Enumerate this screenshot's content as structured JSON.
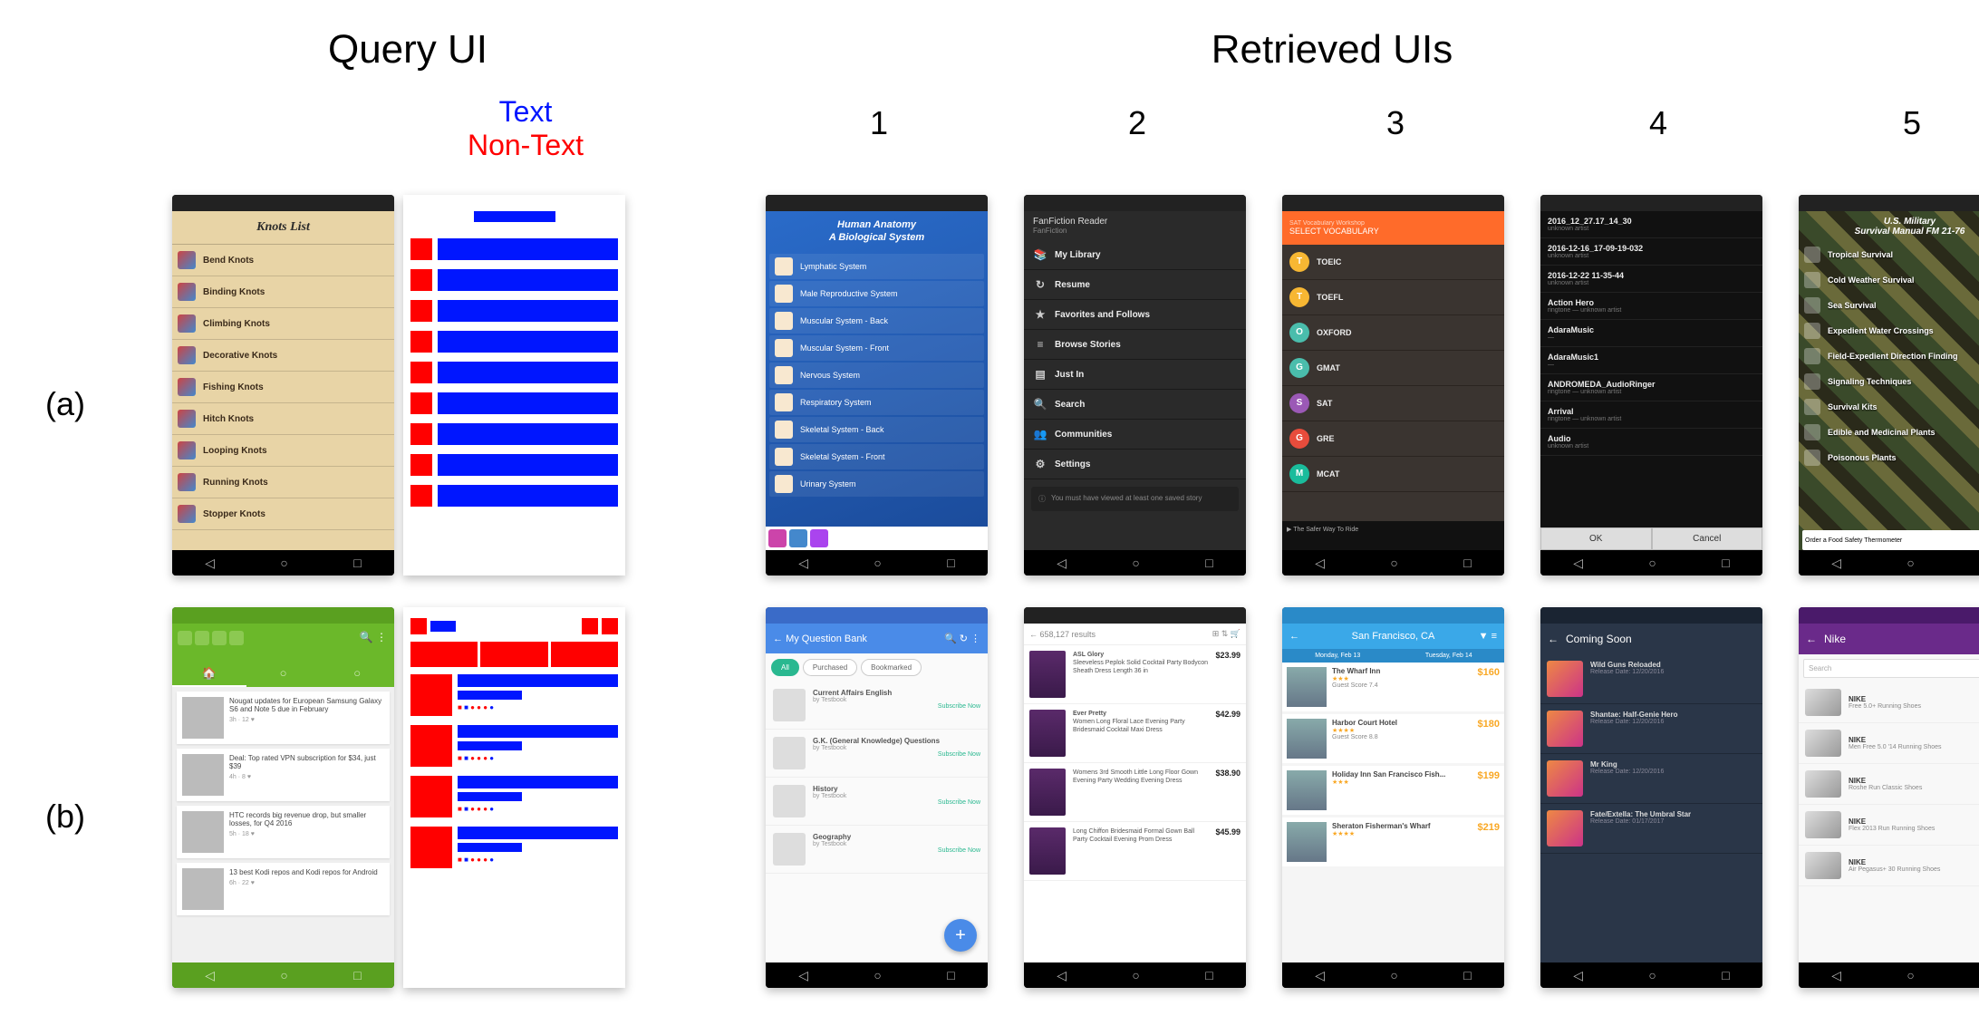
{
  "titles": {
    "query": "Query UI",
    "retrieved": "Retrieved UIs"
  },
  "legend": {
    "text": "Text",
    "nontext": "Non-Text"
  },
  "cols": [
    "1",
    "2",
    "3",
    "4",
    "5"
  ],
  "rows": {
    "a": "(a)",
    "b": "(b)"
  },
  "nav": {
    "back": "◁",
    "home": "○",
    "recent": "□"
  },
  "knots": {
    "title": "Knots List",
    "items": [
      "Bend Knots",
      "Binding Knots",
      "Climbing Knots",
      "Decorative Knots",
      "Fishing Knots",
      "Hitch Knots",
      "Looping Knots",
      "Running Knots",
      "Stopper Knots"
    ]
  },
  "anatomy": {
    "title1": "Human Anatomy",
    "title2": "A Biological System",
    "items": [
      "Lymphatic System",
      "Male Reproductive System",
      "Muscular System - Back",
      "Muscular System - Front",
      "Nervous System",
      "Respiratory System",
      "Skeletal System - Back",
      "Skeletal System - Front",
      "Urinary System"
    ]
  },
  "fanfic": {
    "title": "FanFiction Reader",
    "sub": "FanFiction",
    "items": [
      {
        "icon": "📚",
        "label": "My Library"
      },
      {
        "icon": "↻",
        "label": "Resume"
      },
      {
        "icon": "★",
        "label": "Favorites and Follows"
      },
      {
        "icon": "≡",
        "label": "Browse Stories"
      },
      {
        "icon": "▤",
        "label": "Just In"
      },
      {
        "icon": "🔍",
        "label": "Search"
      },
      {
        "icon": "👥",
        "label": "Communities"
      },
      {
        "icon": "⚙",
        "label": "Settings"
      }
    ],
    "hint": "You must have viewed at least one saved story"
  },
  "vocab": {
    "title": "SELECT VOCABULARY",
    "items": [
      {
        "c": "#f7b733",
        "l": "T",
        "name": "TOEIC"
      },
      {
        "c": "#f7b733",
        "l": "T",
        "name": "TOEFL"
      },
      {
        "c": "#4abdac",
        "l": "O",
        "name": "OXFORD"
      },
      {
        "c": "#4abdac",
        "l": "G",
        "name": "GMAT"
      },
      {
        "c": "#9b59b6",
        "l": "S",
        "name": "SAT"
      },
      {
        "c": "#e74c3c",
        "l": "G",
        "name": "GRE"
      },
      {
        "c": "#1abc9c",
        "l": "M",
        "name": "MCAT"
      }
    ],
    "banner": "The Safer Way To Ride"
  },
  "files": {
    "items": [
      {
        "name": "2016_12_27.17_14_30",
        "meta": "unknown artist"
      },
      {
        "name": "2016-12-16_17-09-19-032",
        "meta": "unknown artist"
      },
      {
        "name": "2016-12-22 11-35-44",
        "meta": "unknown artist"
      },
      {
        "name": "Action Hero",
        "meta": "ringtone — unknown artist"
      },
      {
        "name": "AdaraMusic",
        "meta": "—"
      },
      {
        "name": "AdaraMusic1",
        "meta": "—"
      },
      {
        "name": "ANDROMEDA_AudioRinger",
        "meta": "ringtone — unknown artist"
      },
      {
        "name": "Arrival",
        "meta": "ringtone — unknown artist"
      },
      {
        "name": "Audio",
        "meta": "unknown artist"
      }
    ],
    "ok": "OK",
    "cancel": "Cancel"
  },
  "military": {
    "title1": "U.S. Military",
    "title2": "Survival Manual FM 21-76",
    "items": [
      "Tropical Survival",
      "Cold Weather Survival",
      "Sea Survival",
      "Expedient Water Crossings",
      "Field-Expedient Direction Finding",
      "Signaling Techniques",
      "Survival Kits",
      "Edible and Medicinal Plants",
      "Poisonous Plants"
    ],
    "ad": "Order a Food Safety Thermometer",
    "badge": "5"
  },
  "news": {
    "tabs": [
      "🏠",
      "○",
      "○"
    ],
    "cards": [
      {
        "t": "Nougat updates for European Samsung Galaxy S6 and Note 5 due in February",
        "m": "3h · 12 ♥"
      },
      {
        "t": "Deal: Top rated VPN subscription for $34, just $39",
        "m": "4h · 8 ♥"
      },
      {
        "t": "HTC records big revenue drop, but smaller losses, for Q4 2016",
        "m": "5h · 18 ♥"
      },
      {
        "t": "13 best Kodi repos and Kodi repos for Android",
        "m": "6h · 22 ♥"
      }
    ]
  },
  "qbank": {
    "title": "My Question Bank",
    "tabs": [
      "All",
      "Purchased",
      "Bookmarked"
    ],
    "items": [
      {
        "t": "Current Affairs English",
        "s": "by Testbook"
      },
      {
        "t": "G.K. (General Knowledge) Questions",
        "s": "by Testbook"
      },
      {
        "t": "History",
        "s": "by Testbook"
      },
      {
        "t": "Geography",
        "s": "by Testbook"
      }
    ],
    "action": "Subscribe Now"
  },
  "shop": {
    "results": "658,127 results",
    "items": [
      {
        "t": "ASL Glory",
        "p": "$23.99",
        "d": "Sleeveless Peplok Solid Cocktail Party Bodycon Sheath Dress Length 36 in"
      },
      {
        "t": "Ever Pretty",
        "p": "$42.99",
        "d": "Women Long Floral Lace Evening Party Bridesmaid Cocktail Maxi Dress"
      },
      {
        "t": "",
        "p": "$38.90",
        "d": "Womens 3rd Smooth Little Long Floor Gown Evening Party Wedding Evening Dress"
      },
      {
        "t": "",
        "p": "$45.99",
        "d": "Long Chiffon Bridesmaid Formal Gown Ball Party Cocktail Evening Prom Dress"
      }
    ]
  },
  "hotels": {
    "city": "San Francisco, CA",
    "d1": "Monday, Feb 13",
    "d2": "Tuesday, Feb 14",
    "items": [
      {
        "n": "The Wharf Inn",
        "s": "★★★",
        "sc": "Guest Score 7.4",
        "p": "$160"
      },
      {
        "n": "Harbor Court Hotel",
        "s": "★★★★",
        "sc": "Guest Score 8.8",
        "p": "$180"
      },
      {
        "n": "Holiday Inn San Francisco Fish...",
        "s": "★★★",
        "sc": "",
        "p": "$199"
      },
      {
        "n": "Sheraton Fisherman's Wharf",
        "s": "★★★★",
        "sc": "",
        "p": "$219"
      }
    ]
  },
  "coming": {
    "title": "Coming Soon",
    "items": [
      {
        "t": "Wild Guns Reloaded",
        "m": "Release Date: 12/20/2016"
      },
      {
        "t": "Shantae: Half-Genie Hero",
        "m": "Release Date: 12/20/2016"
      },
      {
        "t": "Mr King",
        "m": "Release Date: 12/20/2016"
      },
      {
        "t": "Fate/Extella: The Umbral Star",
        "m": "Release Date: 01/17/2017"
      }
    ]
  },
  "nike": {
    "title": "Nike",
    "search": "Search",
    "items": [
      {
        "b": "NIKE",
        "d": "Free 5.0+ Running Shoes"
      },
      {
        "b": "NIKE",
        "d": "Men Free 5.0 '14 Running Shoes"
      },
      {
        "b": "NIKE",
        "d": "Roshe Run Classic Shoes"
      },
      {
        "b": "NIKE",
        "d": "Flex 2013 Run Running Shoes"
      },
      {
        "b": "NIKE",
        "d": "Air Pegasus+ 30 Running Shoes"
      }
    ]
  }
}
